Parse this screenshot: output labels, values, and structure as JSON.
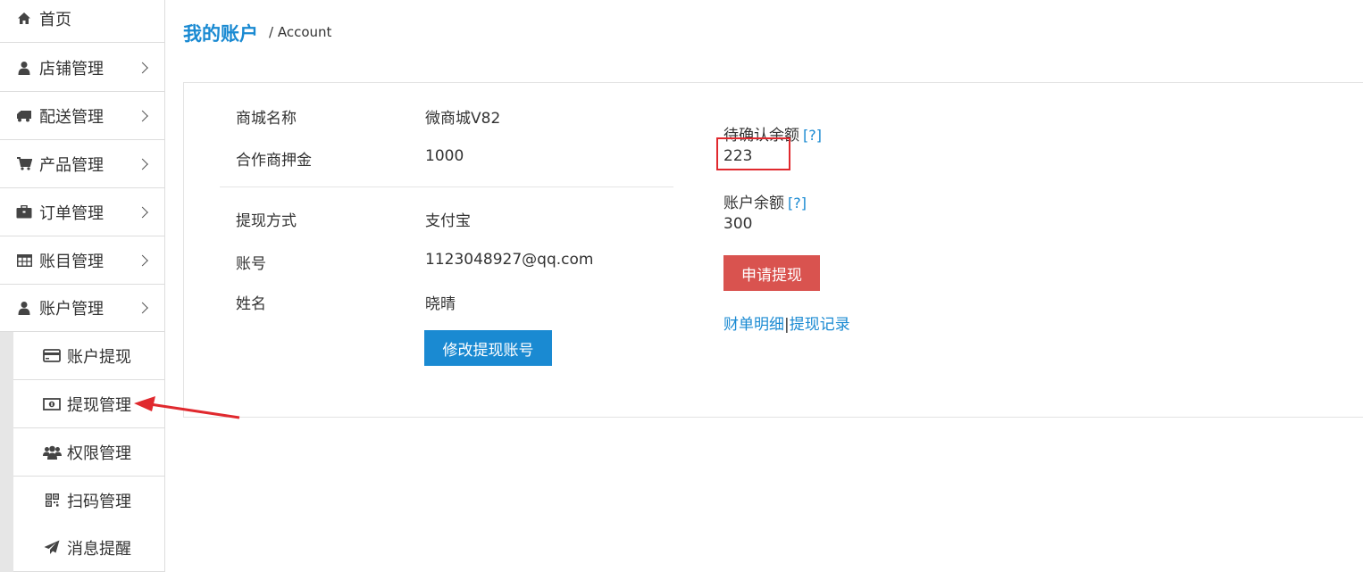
{
  "sidebar": {
    "items": [
      {
        "label": "首页",
        "icon": "home-icon",
        "has_chevron": false
      },
      {
        "label": "店铺管理",
        "icon": "user-icon",
        "has_chevron": true
      },
      {
        "label": "配送管理",
        "icon": "truck-icon",
        "has_chevron": true
      },
      {
        "label": "产品管理",
        "icon": "cart-icon",
        "has_chevron": true
      },
      {
        "label": "订单管理",
        "icon": "briefcase-icon",
        "has_chevron": true
      },
      {
        "label": "账目管理",
        "icon": "table-icon",
        "has_chevron": true
      },
      {
        "label": "账户管理",
        "icon": "user-icon",
        "has_chevron": true
      }
    ],
    "sub_items": [
      {
        "label": "账户提现",
        "icon": "credit-card-icon"
      },
      {
        "label": "提现管理",
        "icon": "money-icon"
      },
      {
        "label": "权限管理",
        "icon": "users-icon"
      },
      {
        "label": "扫码管理",
        "icon": "qrcode-icon"
      },
      {
        "label": "消息提醒",
        "icon": "paper-plane-icon"
      }
    ]
  },
  "header": {
    "title": "我的账户",
    "breadcrumb": "/ Account"
  },
  "account": {
    "shop_name_label": "商城名称",
    "shop_name_value": "微商城V82",
    "deposit_label": "合作商押金",
    "deposit_value": "1000",
    "method_label": "提现方式",
    "method_value": "支付宝",
    "account_label": "账号",
    "account_value": "1123048927@qq.com",
    "name_label": "姓名",
    "name_value": "晓晴",
    "modify_button": "修改提现账号"
  },
  "balance": {
    "pending_label": "待确认余额",
    "pending_help": "[?]",
    "pending_value": "223",
    "balance_label": "账户余额",
    "balance_help": "[?]",
    "balance_value": "300",
    "withdraw_button": "申请提现",
    "link_details": "财单明细",
    "link_separator": "|",
    "link_records": "提现记录"
  },
  "colors": {
    "accent": "#1a8ad2",
    "danger": "#d9534f",
    "annotation": "#e0292e"
  }
}
